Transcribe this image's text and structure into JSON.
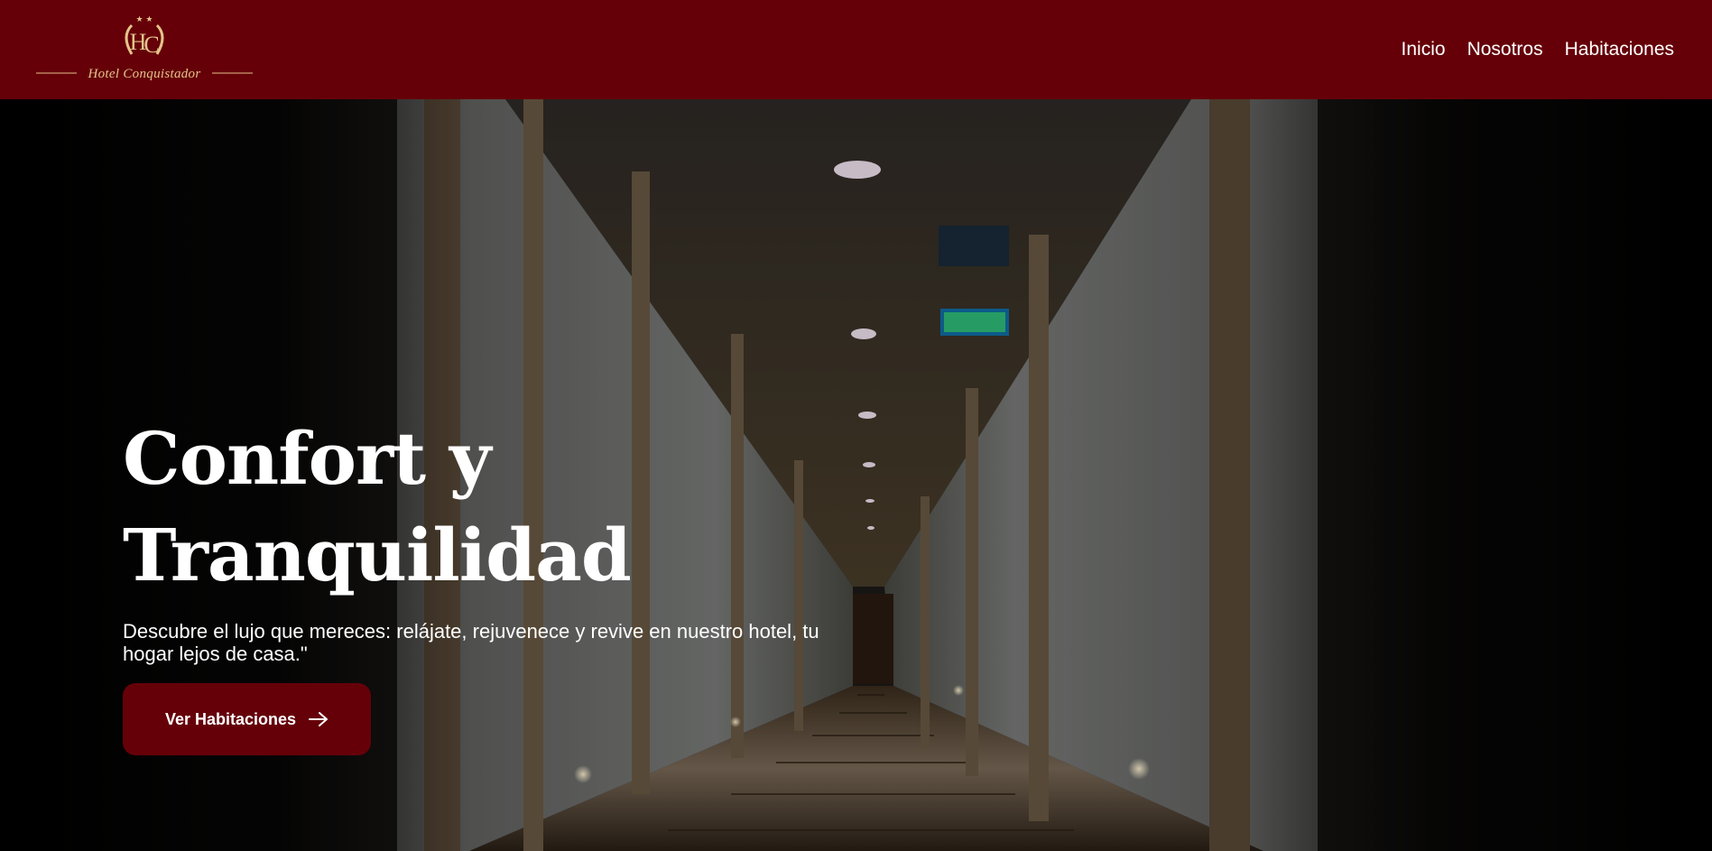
{
  "brand": {
    "monogram": "HC",
    "name": "Hotel Conquistador",
    "stars": "★★",
    "color": "#650009",
    "logo_color": "#e4c48a"
  },
  "nav": {
    "items": [
      {
        "label": "Inicio"
      },
      {
        "label": "Nosotros"
      },
      {
        "label": "Habitaciones"
      }
    ]
  },
  "hero": {
    "title": "Confort y Tranquilidad",
    "subtitle": "Descubre el lujo que mereces: relájate, rejuvenece y revive en nuestro hotel, tu hogar lejos de casa.\"",
    "cta_label": "Ver Habitaciones",
    "cta_icon": "arrow-right-icon",
    "background": "hotel-corridor-photo",
    "exit_sign_icon": "emergency-exit-icon"
  }
}
